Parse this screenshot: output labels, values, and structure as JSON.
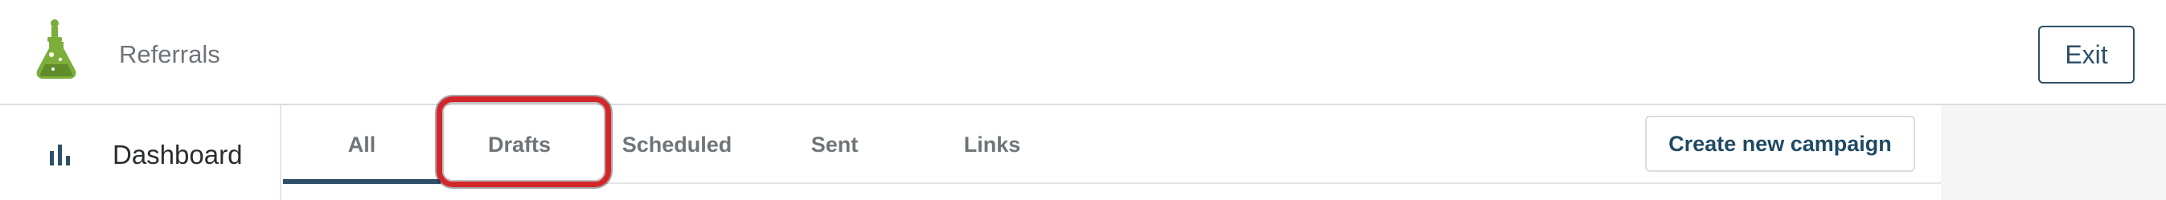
{
  "header": {
    "app_title": "Referrals",
    "exit_label": "Exit",
    "brand_color": "#7cae3a"
  },
  "sidebar": {
    "items": [
      {
        "label": "Dashboard",
        "icon": "bar-chart-icon"
      }
    ]
  },
  "tabs": [
    {
      "label": "All",
      "active": true
    },
    {
      "label": "Drafts",
      "active": false,
      "highlighted": true
    },
    {
      "label": "Scheduled",
      "active": false
    },
    {
      "label": "Sent",
      "active": false
    },
    {
      "label": "Links",
      "active": false
    }
  ],
  "actions": {
    "create_campaign_label": "Create new campaign"
  },
  "colors": {
    "accent": "#2e5068",
    "highlight": "#d3262a",
    "muted_text": "#6f7479"
  }
}
